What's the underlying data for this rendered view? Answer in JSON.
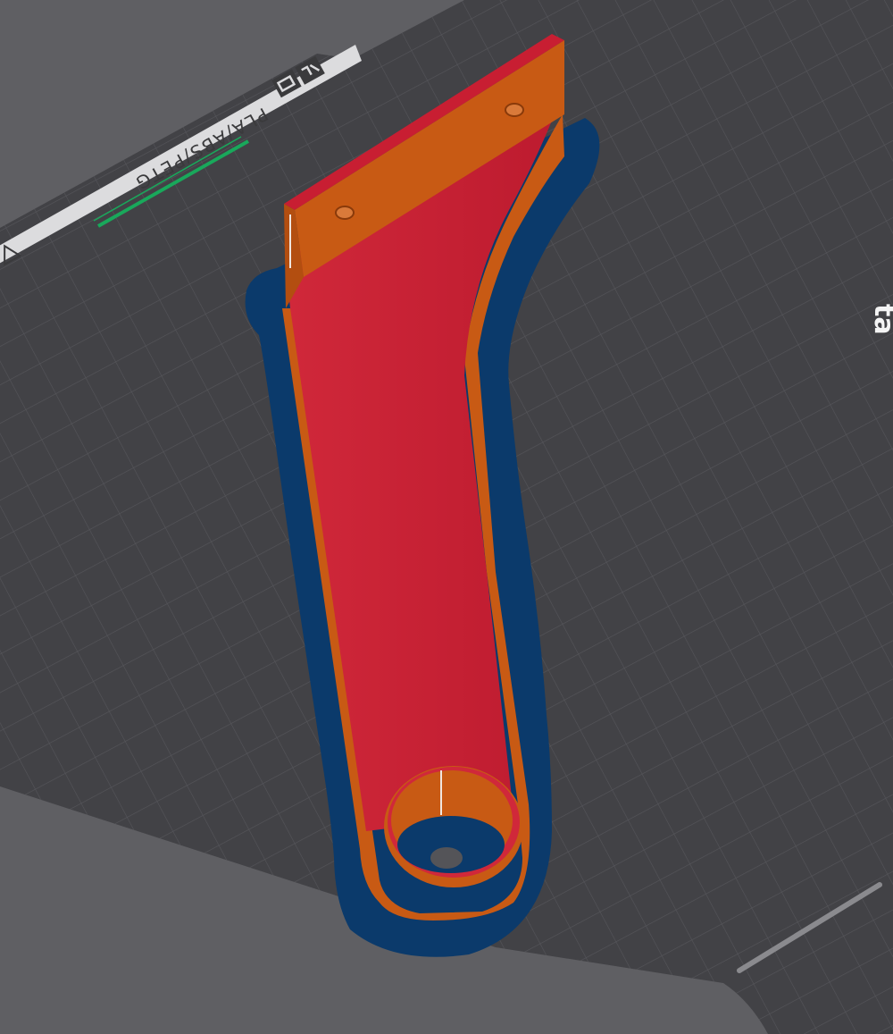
{
  "viewport": {
    "background_color": "#5f5f63"
  },
  "bed": {
    "surface_color": "#424246",
    "grid_color": "#55555a",
    "label_strip_color": "#dcdcde",
    "material_label": "PLA/ABS/PETG",
    "brand_text": "ta",
    "accent_color": "#19a85b",
    "logo_icon": "prusa-logo-icon",
    "warning_icon": "hot-surface-warning-icon"
  },
  "model": {
    "top_color": "#c81e32",
    "wall_color": "#c85a14",
    "skirt_color": "#0b3a6b",
    "hole_color": "#545458",
    "parts": [
      "mounting-plate",
      "arm",
      "ring",
      "screw-hole-left",
      "screw-hole-right",
      "skirt"
    ]
  }
}
